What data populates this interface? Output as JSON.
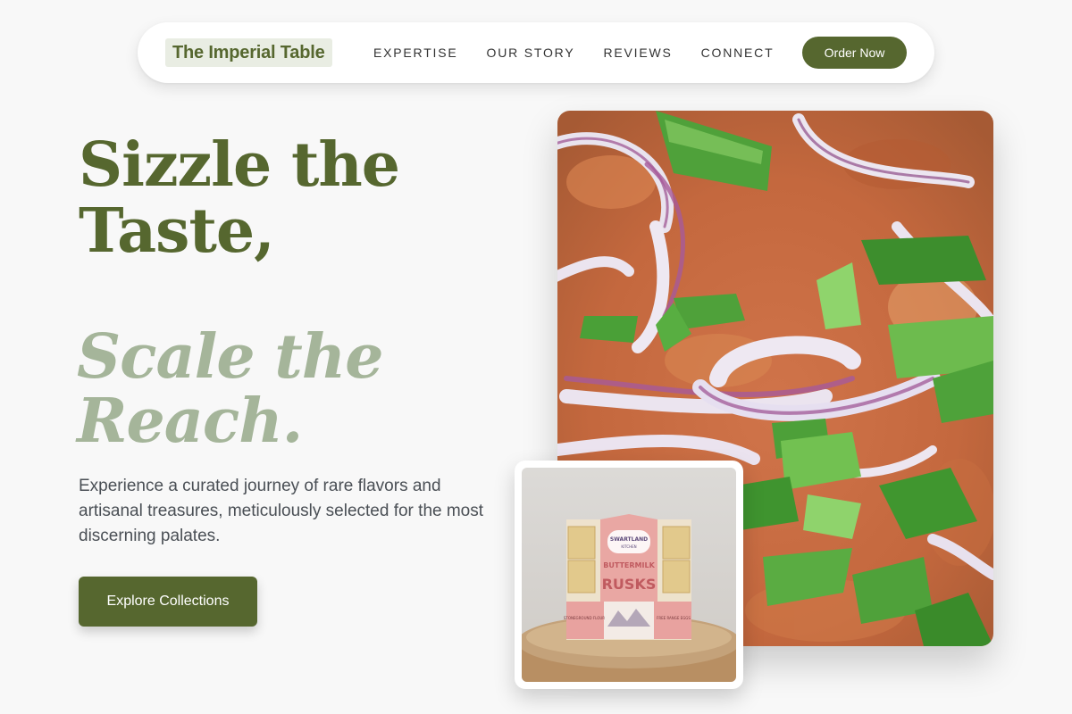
{
  "brand": {
    "name": "The Imperial Table"
  },
  "nav": {
    "links": [
      "EXPERTISE",
      "OUR STORY",
      "REVIEWS",
      "CONNECT"
    ],
    "order_label": "Order Now"
  },
  "hero": {
    "title": "Sizzle the Taste,",
    "subtitle": "Scale the Reach.",
    "lead": "Experience a curated journey of rare flavors and artisanal treasures, meticulously selected for the most discerning palates.",
    "cta_label": "Explore Collections"
  },
  "product": {
    "pack_brand": "SWARTLAND",
    "pack_brand_sub": "KITCHEN",
    "pack_title_1": "BUTTERMILK",
    "pack_title_2": "RUSKS",
    "pack_side_left": "STONEGROUND FLOUR",
    "pack_side_right": "FREE RANGE EGGS"
  },
  "colors": {
    "accent": "#56672f",
    "accent_light": "#a5b59a",
    "background": "#f8f8f8"
  }
}
